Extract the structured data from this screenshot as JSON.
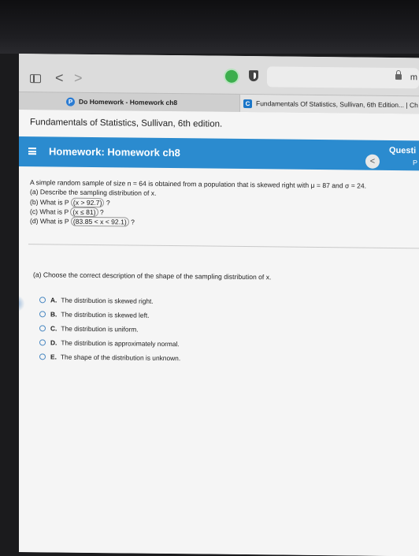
{
  "browser": {
    "nav_back": "<",
    "nav_forward": ">",
    "url_partial": "m",
    "tabs": [
      {
        "label": "Do Homework - Homework ch8",
        "favicon": "P"
      },
      {
        "label": "Fundamentals Of Statistics, Sullivan, 6th Edition... | Ch",
        "favicon": "C"
      }
    ]
  },
  "page": {
    "book_title": "Fundamentals of Statistics, Sullivan, 6th edition.",
    "homework_title": "Homework: Homework ch8",
    "question_label": "Questi",
    "question_sub": "P",
    "back_symbol": "<"
  },
  "problem": {
    "intro": "A simple random sample of size n = 64 is obtained from a population that is skewed right with μ = 87 and σ = 24.",
    "part_a": "(a) Describe the sampling distribution of x.",
    "part_b_pre": "(b) What is P ",
    "part_b_expr": "(x > 92.7)",
    "part_b_post": " ?",
    "part_c_pre": "(c) What is P ",
    "part_c_expr": "(x ≤ 81)",
    "part_c_post": " ?",
    "part_d_pre": "(d) What is P ",
    "part_d_expr": "(83.85 < x < 92.1)",
    "part_d_post": " ?"
  },
  "question": {
    "prompt": "(a) Choose the correct description of the shape of the sampling distribution of x.",
    "options": [
      {
        "letter": "A.",
        "text": "The distribution is skewed right."
      },
      {
        "letter": "B.",
        "text": "The distribution is skewed left."
      },
      {
        "letter": "C.",
        "text": "The distribution is uniform."
      },
      {
        "letter": "D.",
        "text": "The distribution is approximately normal."
      },
      {
        "letter": "E.",
        "text": "The shape of the distribution is unknown."
      }
    ]
  },
  "colors": {
    "header_blue": "#2b8bcf",
    "radio_blue": "#4b89c2"
  }
}
